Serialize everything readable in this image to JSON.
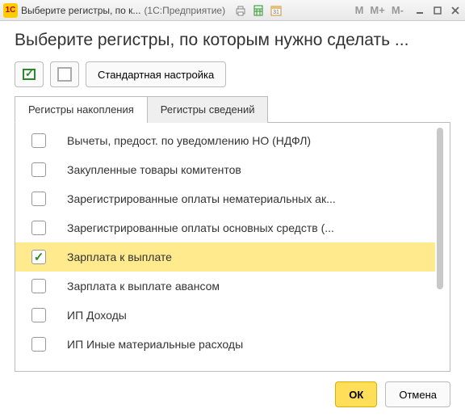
{
  "titlebar": {
    "app_icon_label": "1C",
    "title": "Выберите регистры, по к...",
    "parenthetic": "(1С:Предприятие)"
  },
  "heading": "Выберите регистры, по которым нужно сделать ...",
  "toolbar": {
    "default_settings_label": "Стандартная настройка"
  },
  "tabs": [
    {
      "label": "Регистры накопления",
      "active": true
    },
    {
      "label": "Регистры сведений",
      "active": false
    }
  ],
  "rows": [
    {
      "label": "Вычеты, предост. по уведомлению НО (НДФЛ)",
      "checked": false,
      "selected": false
    },
    {
      "label": "Закупленные товары комитентов",
      "checked": false,
      "selected": false
    },
    {
      "label": "Зарегистрированные оплаты нематериальных ак...",
      "checked": false,
      "selected": false
    },
    {
      "label": "Зарегистрированные оплаты основных средств (...",
      "checked": false,
      "selected": false
    },
    {
      "label": "Зарплата к выплате",
      "checked": true,
      "selected": true
    },
    {
      "label": "Зарплата к выплате авансом",
      "checked": false,
      "selected": false
    },
    {
      "label": "ИП Доходы",
      "checked": false,
      "selected": false
    },
    {
      "label": "ИП Иные материальные расходы",
      "checked": false,
      "selected": false
    }
  ],
  "footer": {
    "ok_label": "ОК",
    "cancel_label": "Отмена"
  }
}
